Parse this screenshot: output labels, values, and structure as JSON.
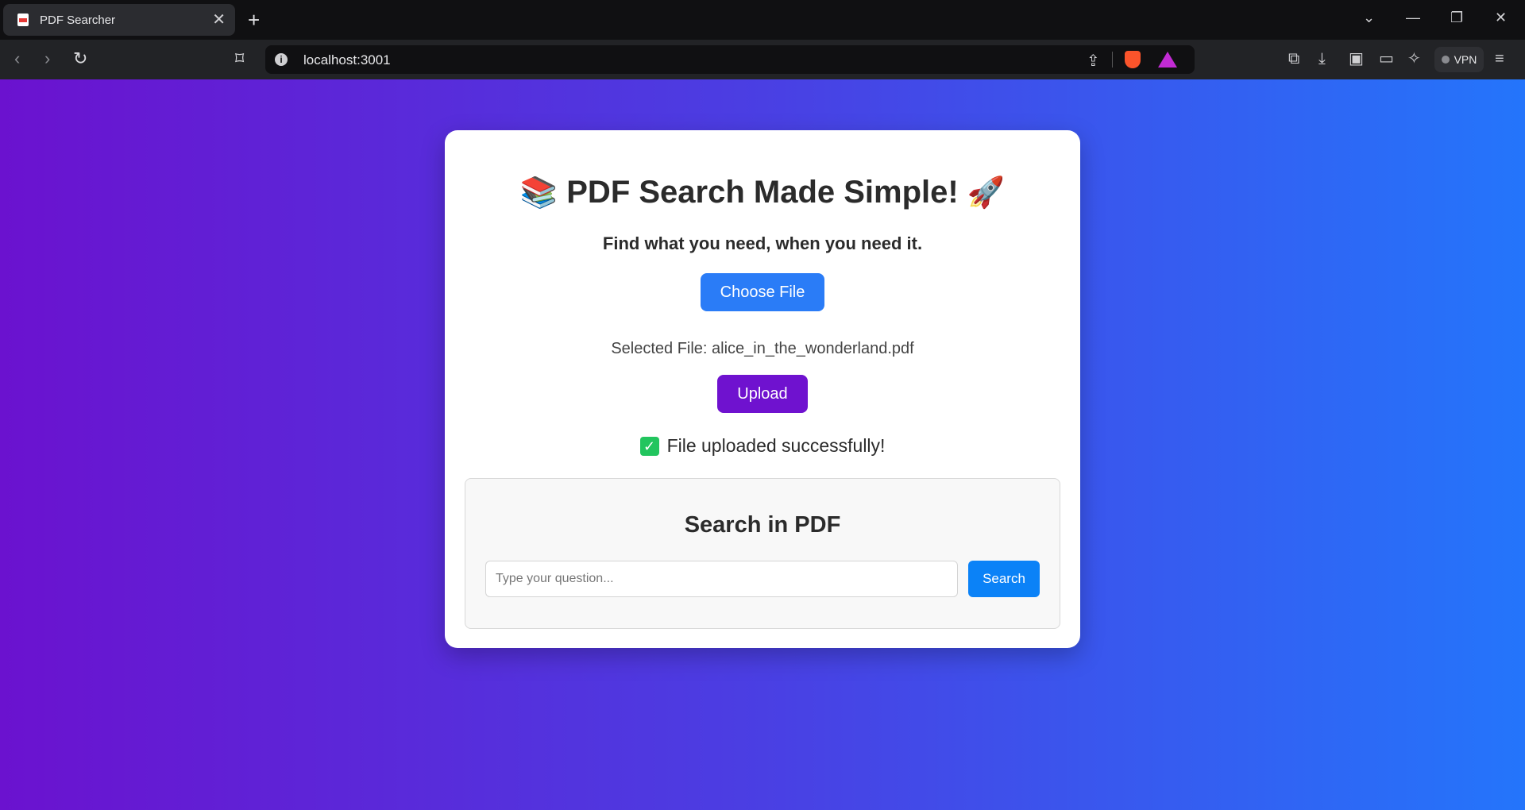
{
  "browser": {
    "tab_title": "PDF Searcher",
    "url": "localhost:3001",
    "vpn_label": "VPN"
  },
  "app": {
    "heading_emoji_left": "📚",
    "heading_text": "PDF Search Made Simple!",
    "heading_emoji_right": "🚀",
    "subtitle": "Find what you need, when you need it.",
    "choose_file_label": "Choose File",
    "selected_file_text": "Selected File: alice_in_the_wonderland.pdf",
    "upload_label": "Upload",
    "success_message": "File uploaded successfully!",
    "search": {
      "title": "Search in PDF",
      "placeholder": "Type your question...",
      "value": "",
      "button_label": "Search"
    }
  },
  "colors": {
    "gradient_start": "#6b12cf",
    "gradient_end": "#2475fb",
    "choose_button": "#2a7cf7",
    "upload_button": "#6f12cf",
    "search_button": "#0b82f7",
    "success_check": "#22c55e"
  }
}
